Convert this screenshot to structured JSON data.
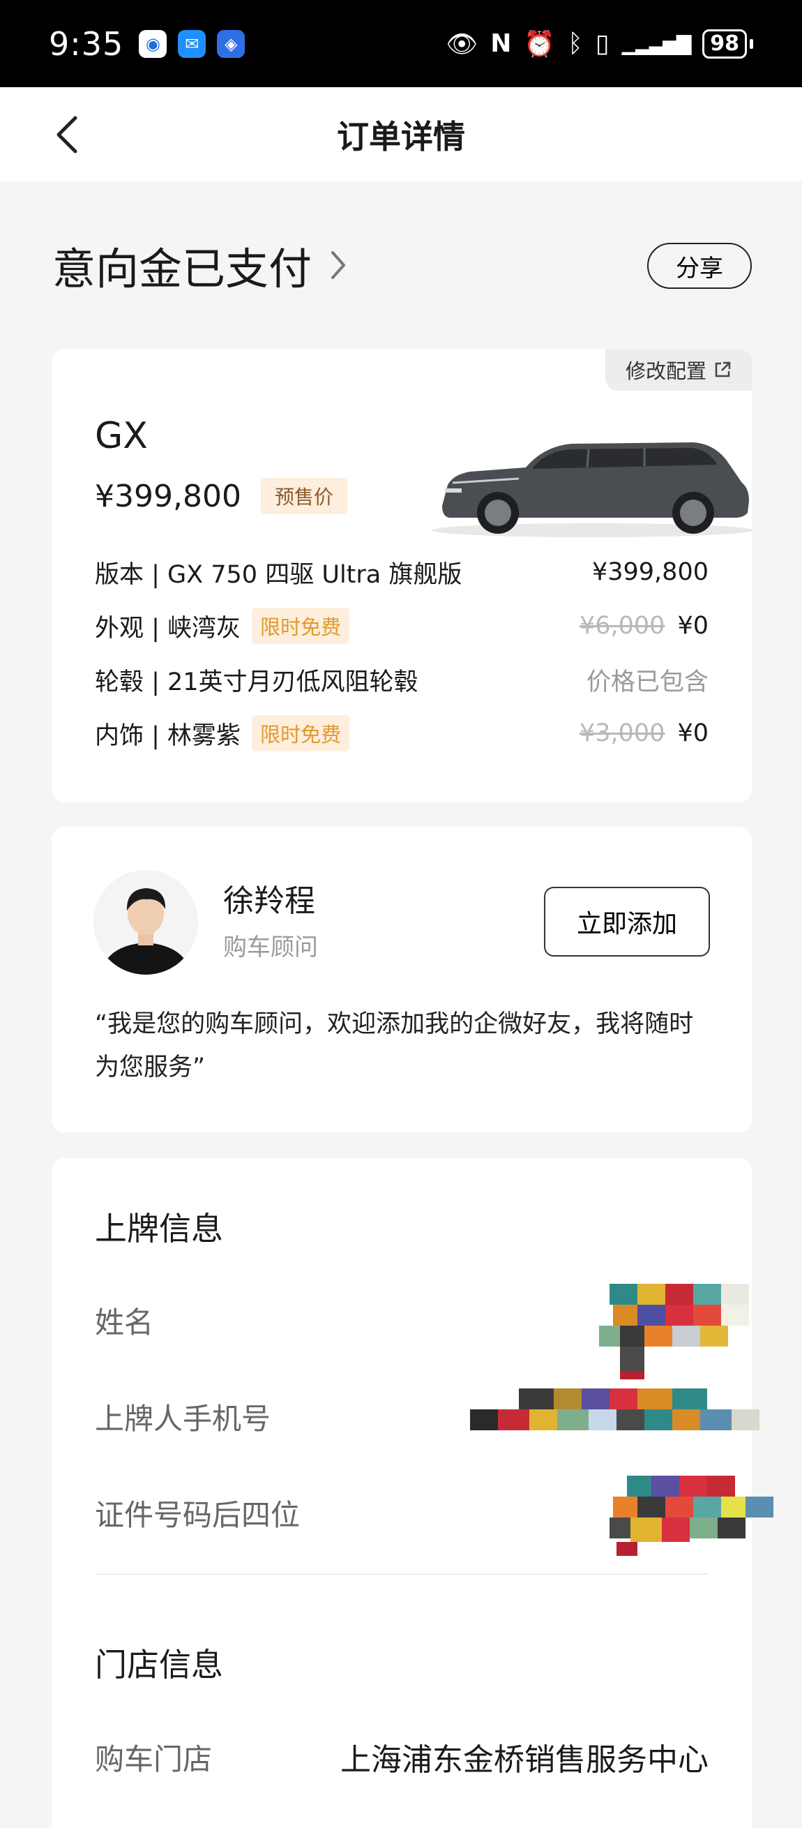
{
  "status_bar": {
    "time": "9:35",
    "battery": "98",
    "icons": [
      "eye-icon",
      "nfc-icon",
      "alarm-icon",
      "bluetooth-icon",
      "vibrate-icon",
      "signal-icon"
    ]
  },
  "nav": {
    "title": "订单详情"
  },
  "order": {
    "status": "意向金已支付",
    "share_label": "分享"
  },
  "car": {
    "modify_label": "修改配置",
    "model": "GX",
    "price": "¥399,800",
    "price_tag": "预售价",
    "specs": [
      {
        "label": "版本 | GX 750 四驱 Ultra 旗舰版",
        "tag": "",
        "original": "",
        "price": "¥399,800"
      },
      {
        "label": "外观 | 峡湾灰",
        "tag": "限时免费",
        "original": "¥6,000",
        "price": "¥0"
      },
      {
        "label": "轮毂 | 21英寸月刃低风阻轮毂",
        "tag": "",
        "original": "",
        "price": "价格已包含"
      },
      {
        "label": "内饰 | 林雾紫",
        "tag": "限时免费",
        "original": "¥3,000",
        "price": "¥0"
      }
    ]
  },
  "advisor": {
    "name": "徐羚程",
    "role": "购车顾问",
    "add_label": "立即添加",
    "message": "“我是您的购车顾问，欢迎添加我的企微好友，我将随时为您服务”"
  },
  "plate": {
    "title": "上牌信息",
    "fields": [
      "姓名",
      "上牌人手机号",
      "证件号码后四位"
    ]
  },
  "store": {
    "title": "门店信息",
    "label": "购车门店",
    "value": "上海浦东金桥销售服务中心"
  }
}
